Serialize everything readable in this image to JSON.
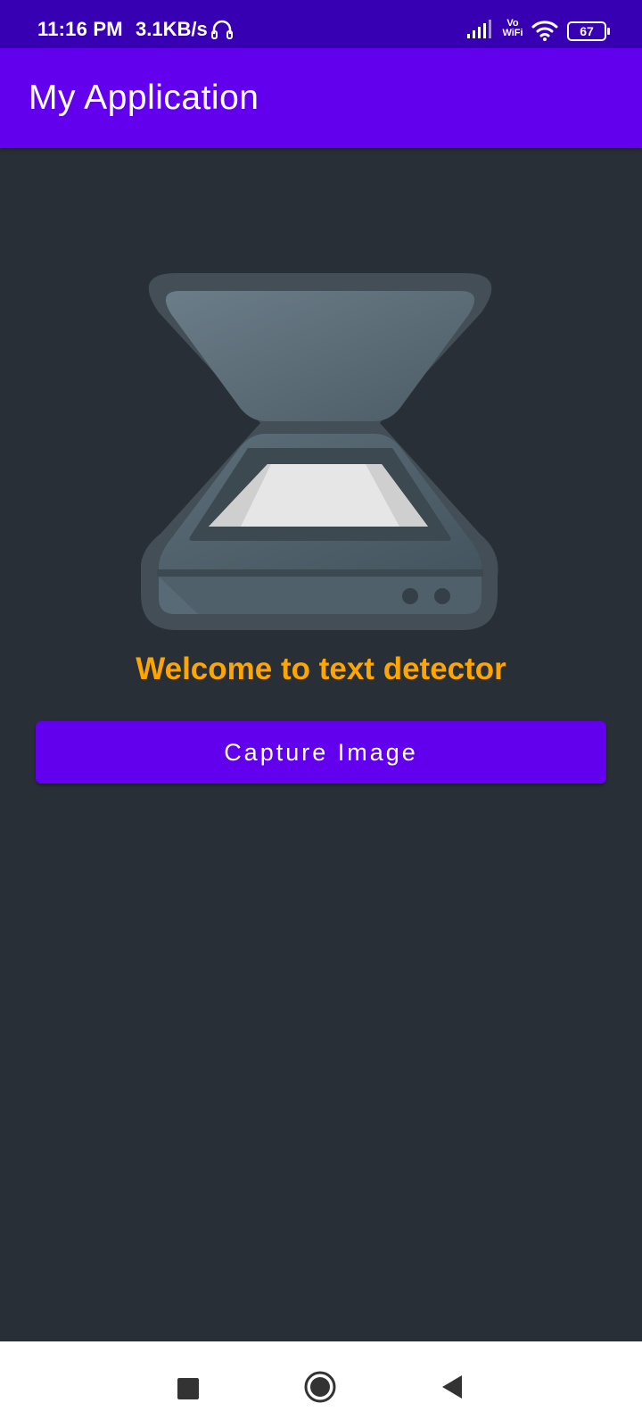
{
  "status_bar": {
    "time": "11:16 PM",
    "network_speed": "3.1KB/s",
    "vowifi_line1": "Vo",
    "vowifi_line2": "WiFi",
    "battery_level": "67",
    "icons": [
      "headset-icon",
      "signal-icon",
      "vowifi-icon",
      "wifi-icon",
      "battery-icon"
    ]
  },
  "app_bar": {
    "title": "My Application",
    "color": "#6200ee"
  },
  "main": {
    "image_icon": "scanner-icon",
    "welcome_text": "Welcome to text detector",
    "welcome_color": "#ffa500",
    "capture_button_label": "Capture Image",
    "background_color": "#292f36"
  },
  "nav_bar": {
    "icons": [
      "recents-icon",
      "home-icon",
      "back-icon"
    ]
  }
}
